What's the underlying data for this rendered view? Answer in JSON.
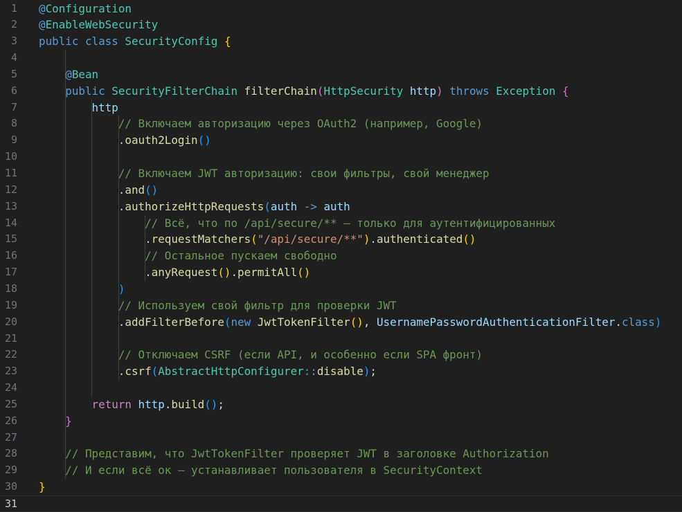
{
  "colors": {
    "background": "#1f1f1f",
    "line_number": "#6e7681",
    "keyword": "#569cd6",
    "control_keyword": "#c586c0",
    "type": "#4ec9b0",
    "function": "#dcdcaa",
    "variable": "#9cdcfe",
    "string": "#ce9178",
    "comment": "#6a9955",
    "punctuation": "#d4d4d4",
    "bracket_level_1": "#ffd700",
    "bracket_level_2": "#da70d6",
    "bracket_level_3": "#179fff"
  },
  "editor": {
    "current_line": 31,
    "lines": [
      {
        "n": "1",
        "tokens": [
          [
            "kw",
            "@"
          ],
          [
            "ty",
            "Configuration"
          ]
        ]
      },
      {
        "n": "2",
        "tokens": [
          [
            "kw",
            "@"
          ],
          [
            "ty",
            "EnableWebSecurity"
          ]
        ]
      },
      {
        "n": "3",
        "tokens": [
          [
            "kw",
            "public"
          ],
          [
            "p",
            " "
          ],
          [
            "kw",
            "class"
          ],
          [
            "p",
            " "
          ],
          [
            "ty",
            "SecurityConfig"
          ],
          [
            "p",
            " "
          ],
          [
            "b1",
            "{"
          ]
        ]
      },
      {
        "n": "4",
        "tokens": []
      },
      {
        "n": "5",
        "tokens": [
          [
            "p",
            "    "
          ],
          [
            "kw",
            "@"
          ],
          [
            "ty",
            "Bean"
          ]
        ]
      },
      {
        "n": "6",
        "tokens": [
          [
            "p",
            "    "
          ],
          [
            "kw",
            "public"
          ],
          [
            "p",
            " "
          ],
          [
            "ty",
            "SecurityFilterChain"
          ],
          [
            "p",
            " "
          ],
          [
            "fn",
            "filterChain"
          ],
          [
            "b2",
            "("
          ],
          [
            "ty",
            "HttpSecurity"
          ],
          [
            "p",
            " "
          ],
          [
            "var",
            "http"
          ],
          [
            "b2",
            ")"
          ],
          [
            "p",
            " "
          ],
          [
            "kw",
            "throws"
          ],
          [
            "p",
            " "
          ],
          [
            "ty",
            "Exception"
          ],
          [
            "p",
            " "
          ],
          [
            "b2",
            "{"
          ]
        ]
      },
      {
        "n": "7",
        "tokens": [
          [
            "p",
            "        "
          ],
          [
            "var",
            "http"
          ]
        ]
      },
      {
        "n": "8",
        "tokens": [
          [
            "p",
            "            "
          ],
          [
            "cmt",
            "// Включаем авторизацию через OAuth2 (например, Google)"
          ]
        ]
      },
      {
        "n": "9",
        "tokens": [
          [
            "p",
            "            ."
          ],
          [
            "fn",
            "oauth2Login"
          ],
          [
            "b3",
            "()"
          ]
        ]
      },
      {
        "n": "10",
        "tokens": []
      },
      {
        "n": "11",
        "tokens": [
          [
            "p",
            "            "
          ],
          [
            "cmt",
            "// Включаем JWT авторизацию: свои фильтры, свой менеджер"
          ]
        ]
      },
      {
        "n": "12",
        "tokens": [
          [
            "p",
            "            ."
          ],
          [
            "fn",
            "and"
          ],
          [
            "b3",
            "()"
          ]
        ]
      },
      {
        "n": "13",
        "tokens": [
          [
            "p",
            "            ."
          ],
          [
            "fn",
            "authorizeHttpRequests"
          ],
          [
            "b3",
            "("
          ],
          [
            "var",
            "auth"
          ],
          [
            "p",
            " "
          ],
          [
            "kw",
            "->"
          ],
          [
            "p",
            " "
          ],
          [
            "var",
            "auth"
          ]
        ]
      },
      {
        "n": "14",
        "tokens": [
          [
            "p",
            "                "
          ],
          [
            "cmt",
            "// Всё, что по /api/secure/** — только для аутентифицированных"
          ]
        ]
      },
      {
        "n": "15",
        "tokens": [
          [
            "p",
            "                ."
          ],
          [
            "fn",
            "requestMatchers"
          ],
          [
            "b1",
            "("
          ],
          [
            "str",
            "\"/api/secure/**\""
          ],
          [
            "b1",
            ")"
          ],
          [
            "p",
            "."
          ],
          [
            "fn",
            "authenticated"
          ],
          [
            "b1",
            "()"
          ]
        ]
      },
      {
        "n": "16",
        "tokens": [
          [
            "p",
            "                "
          ],
          [
            "cmt",
            "// Остальное пускаем свободно"
          ]
        ]
      },
      {
        "n": "17",
        "tokens": [
          [
            "p",
            "                ."
          ],
          [
            "fn",
            "anyRequest"
          ],
          [
            "b1",
            "()"
          ],
          [
            "p",
            "."
          ],
          [
            "fn",
            "permitAll"
          ],
          [
            "b1",
            "()"
          ]
        ]
      },
      {
        "n": "18",
        "tokens": [
          [
            "p",
            "            "
          ],
          [
            "b3",
            ")"
          ]
        ]
      },
      {
        "n": "19",
        "tokens": [
          [
            "p",
            "            "
          ],
          [
            "cmt",
            "// Используем свой фильтр для проверки JWT"
          ]
        ]
      },
      {
        "n": "20",
        "tokens": [
          [
            "p",
            "            ."
          ],
          [
            "fn",
            "addFilterBefore"
          ],
          [
            "b3",
            "("
          ],
          [
            "kw",
            "new"
          ],
          [
            "p",
            " "
          ],
          [
            "fn",
            "JwtTokenFilter"
          ],
          [
            "b1",
            "()"
          ],
          [
            "p",
            ", "
          ],
          [
            "var",
            "UsernamePasswordAuthenticationFilter"
          ],
          [
            "p",
            "."
          ],
          [
            "kw",
            "class"
          ],
          [
            "b3",
            ")"
          ]
        ]
      },
      {
        "n": "21",
        "tokens": []
      },
      {
        "n": "22",
        "tokens": [
          [
            "p",
            "            "
          ],
          [
            "cmt",
            "// Отключаем CSRF (если API, и особенно если SPA фронт)"
          ]
        ]
      },
      {
        "n": "23",
        "tokens": [
          [
            "p",
            "            ."
          ],
          [
            "fn",
            "csrf"
          ],
          [
            "b3",
            "("
          ],
          [
            "ty",
            "AbstractHttpConfigurer"
          ],
          [
            "kw",
            "::"
          ],
          [
            "fn",
            "disable"
          ],
          [
            "b3",
            ")"
          ],
          [
            "p",
            ";"
          ]
        ]
      },
      {
        "n": "24",
        "tokens": []
      },
      {
        "n": "25",
        "tokens": [
          [
            "p",
            "        "
          ],
          [
            "ctl",
            "return"
          ],
          [
            "p",
            " "
          ],
          [
            "var",
            "http"
          ],
          [
            "p",
            "."
          ],
          [
            "fn",
            "build"
          ],
          [
            "b3",
            "()"
          ],
          [
            "p",
            ";"
          ]
        ]
      },
      {
        "n": "26",
        "tokens": [
          [
            "p",
            "    "
          ],
          [
            "b2",
            "}"
          ]
        ]
      },
      {
        "n": "27",
        "tokens": []
      },
      {
        "n": "28",
        "tokens": [
          [
            "p",
            "    "
          ],
          [
            "cmt",
            "// Представим, что JwtTokenFilter проверяет JWT в заголовке Authorization"
          ]
        ]
      },
      {
        "n": "29",
        "tokens": [
          [
            "p",
            "    "
          ],
          [
            "cmt",
            "// И если всё ок — устанавливает пользователя в SecurityContext"
          ]
        ]
      },
      {
        "n": "30",
        "tokens": [
          [
            "b1",
            "}"
          ]
        ]
      },
      {
        "n": "31",
        "tokens": []
      }
    ]
  }
}
